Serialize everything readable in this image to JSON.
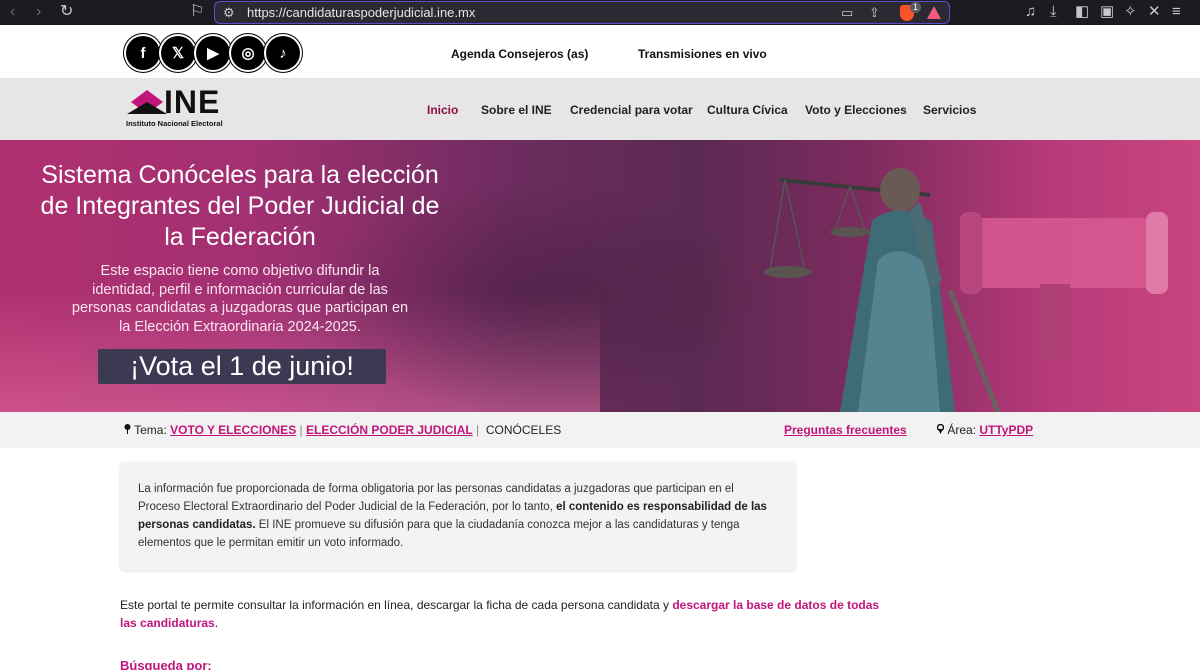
{
  "browser": {
    "url": "https://candidaturaspoderjudicial.ine.mx",
    "brave_badge": "1"
  },
  "social": [
    {
      "name": "facebook",
      "glyph": "f"
    },
    {
      "name": "x",
      "glyph": "𝕏"
    },
    {
      "name": "youtube",
      "glyph": "▶"
    },
    {
      "name": "instagram",
      "glyph": "◎"
    },
    {
      "name": "tiktok",
      "glyph": "♪"
    }
  ],
  "toplinks": {
    "agenda": "Agenda Consejeros (as)",
    "live": "Transmisiones en vivo"
  },
  "logo": {
    "text": "INE",
    "subtitle": "Instituto Nacional Electoral"
  },
  "nav": {
    "inicio": "Inicio",
    "sobre": "Sobre el INE",
    "credencial": "Credencial para votar",
    "cultura": "Cultura Cívica",
    "voto": "Voto y Elecciones",
    "servicios": "Servicios"
  },
  "hero": {
    "title": "Sistema Conóceles para la elección de Integrantes del Poder Judicial de la Federación",
    "description": "Este espacio tiene como objetivo difundir la identidad, perfil e información curricular de las personas candidatas a juzgadoras que participan en la Elección Extraordinaria 2024-2025.",
    "cta": "¡Vota el 1 de junio!"
  },
  "breadcrumb": {
    "label": "Tema:",
    "crumb1": "VOTO Y ELECCIONES",
    "crumb2": "ELECCIÓN PODER JUDICIAL",
    "current": "CONÓCELES",
    "faq": "Preguntas frecuentes",
    "area_label": "Área:",
    "area_value": "UTTyPDP"
  },
  "notice": {
    "part1": "La información fue proporcionada de forma obligatoria por las personas candidatas a juzgadoras que participan en el Proceso Electoral Extraordinario del Poder Judicial de la Federación, por lo tanto, ",
    "bold": "el contenido es responsabilidad de las personas candidatas.",
    "part2": " El INE promueve su difusión para que la ciudadanía conozca mejor a las candidaturas y tenga elementos que le permitan emitir un voto informado."
  },
  "portal": {
    "text": "Este portal te permite consultar la información en línea, descargar la ficha de cada persona candidata y ",
    "link": "descargar la base de datos de todas las candidaturas",
    "end": "."
  },
  "search_heading": "Búsqueda por:",
  "colors": {
    "brand_pink": "#c0157a",
    "active_nav": "#8e0b43",
    "cta_bg": "#3c3a52"
  }
}
